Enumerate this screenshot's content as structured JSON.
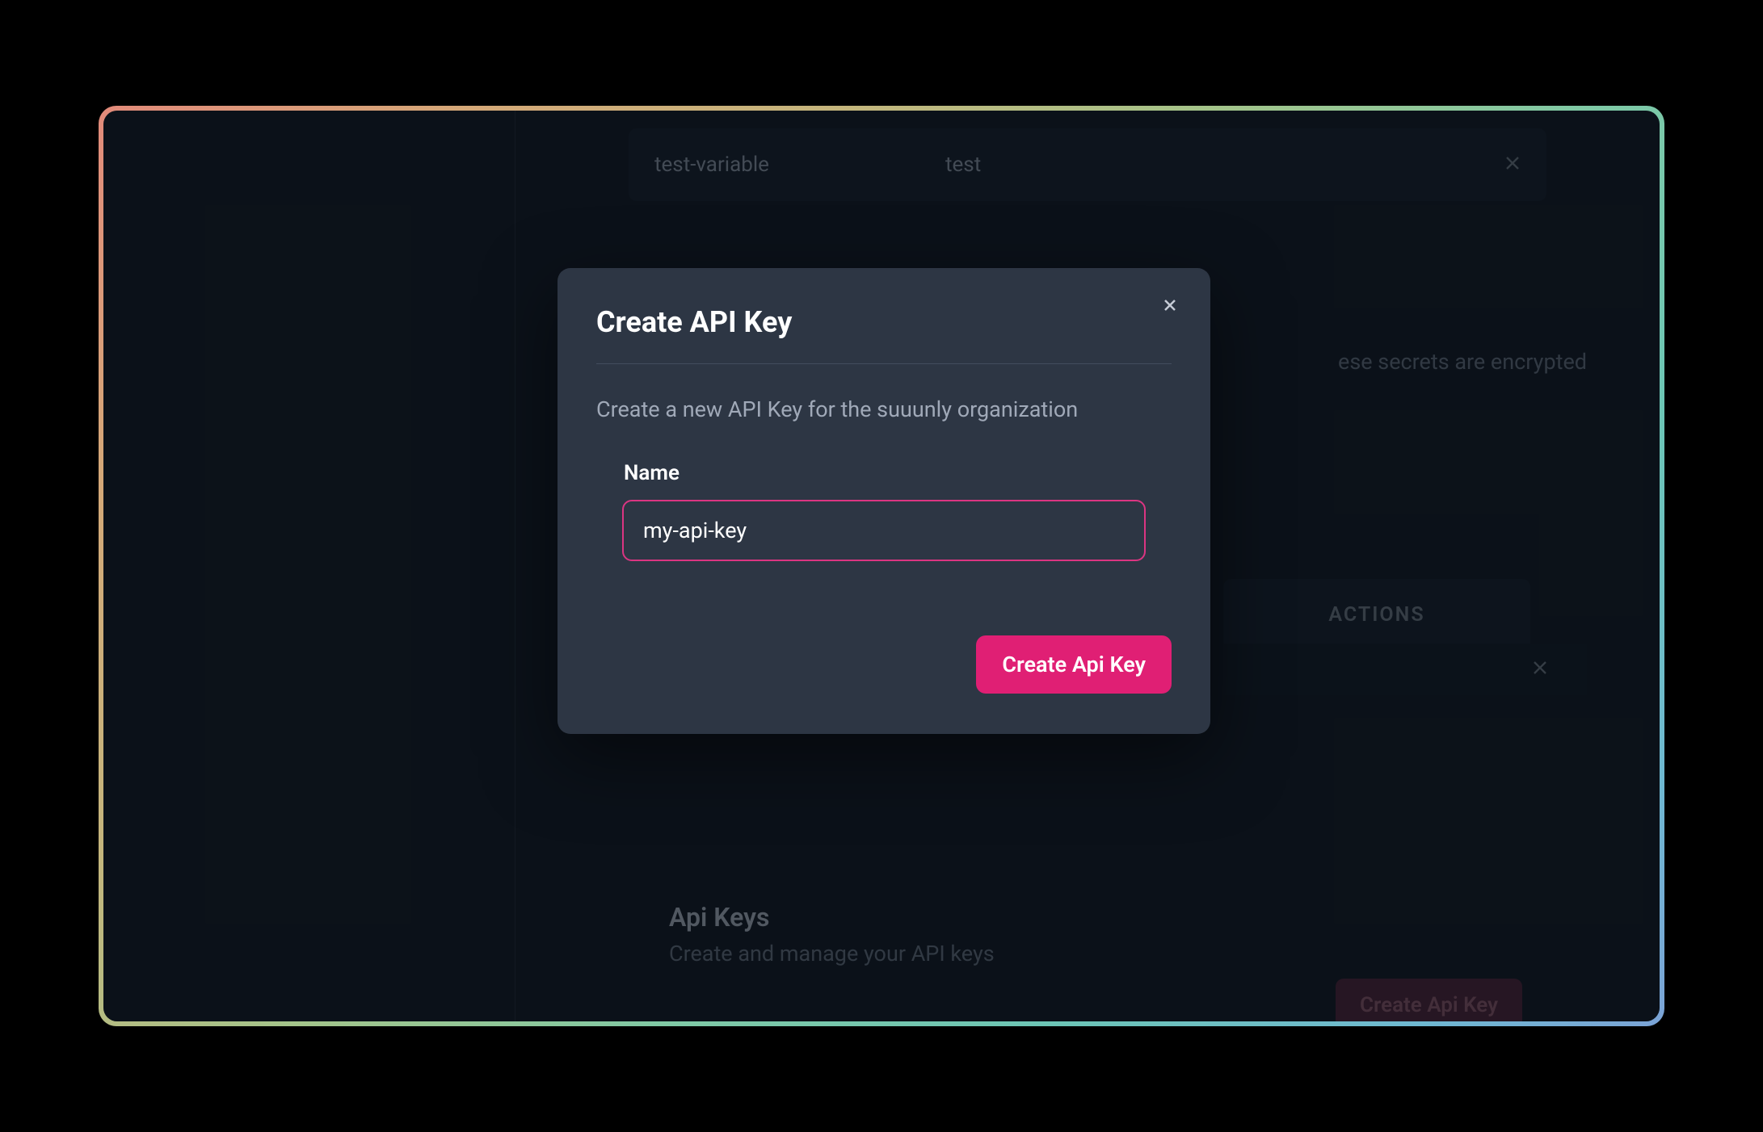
{
  "background": {
    "variable_row": {
      "name": "test-variable",
      "value": "test"
    },
    "secrets_text": "ese secrets are encrypted",
    "actions_header": "ACTIONS",
    "api_keys": {
      "title": "Api Keys",
      "description": "Create and manage your API keys",
      "create_button": "Create Api Key"
    }
  },
  "modal": {
    "title": "Create API Key",
    "description": "Create a new API Key for the suuunly organization",
    "field_label": "Name",
    "input_value": "my-api-key",
    "submit_label": "Create Api Key"
  }
}
